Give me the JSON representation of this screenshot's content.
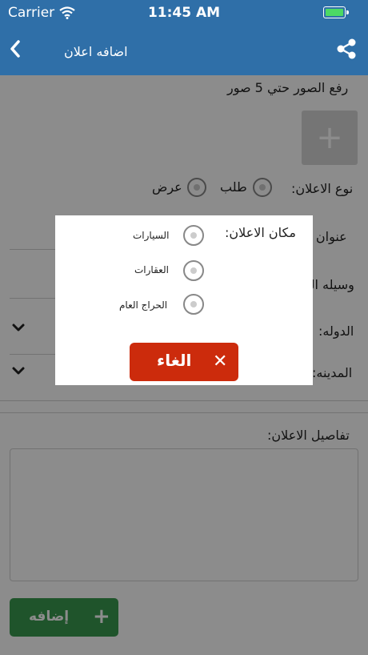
{
  "status_bar": {
    "carrier": "Carrier",
    "time": "11:45 AM"
  },
  "nav": {
    "title": "اضافه اعلان"
  },
  "form": {
    "upload_label": "رفع الصور حتي 5 صور",
    "ad_type_label": "نوع الاعلان:",
    "ad_type_options": [
      "طلب",
      "عرض"
    ],
    "ad_title_label": "عنوان الاعلان:",
    "contact_label": "وسيله التواصل:",
    "country_label": "الدوله:",
    "city_label": "المدينه:",
    "details_label": "تفاصيل الاعلان:",
    "add_button": "إضافه"
  },
  "modal": {
    "title": "مكان الاعلان:",
    "options": [
      "السيارات",
      "العقارات",
      "الحراج العام"
    ],
    "cancel_button": "الغاء"
  },
  "icons": {
    "back": "chevron-left-icon",
    "share": "share-icon",
    "wifi": "wifi-icon",
    "battery": "battery-icon",
    "dropdown": "chevron-down-icon",
    "add": "plus-icon",
    "cancel": "close-icon"
  },
  "colors": {
    "primary": "#2f6fa8",
    "add_green": "#3a9a4f",
    "cancel_red": "#cc2b0c"
  }
}
